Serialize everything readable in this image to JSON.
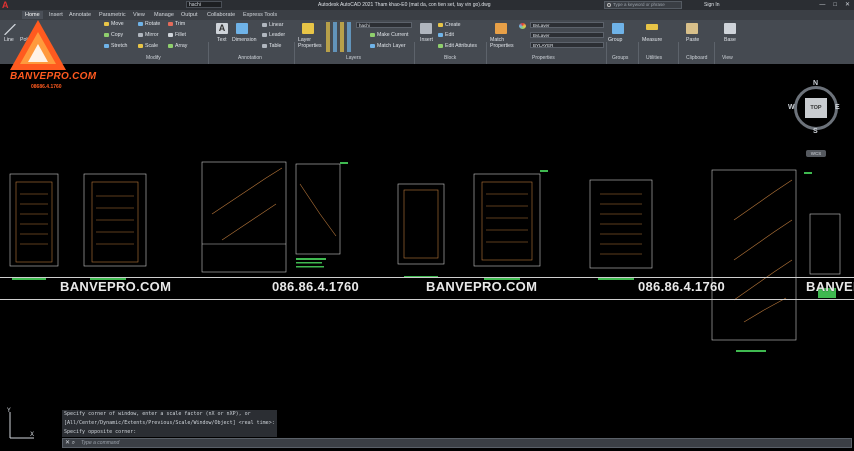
{
  "titlebar": {
    "app_logo": "A",
    "layer_quick": "hachi",
    "title": "Autodesk AutoCAD 2021   Tham khao-E0 (mat da, con tien set, tay vin go).dwg",
    "search_placeholder": "Type a keyword or phrase",
    "sign_in": "Sign In",
    "window_buttons": [
      "—",
      "□",
      "✕"
    ]
  },
  "tabs": [
    "Home",
    "Insert",
    "Annotate",
    "Parametric",
    "View",
    "Manage",
    "Output",
    "Collaborate",
    "Express Tools"
  ],
  "ribbon": {
    "draw": {
      "line": "Line",
      "polyline": "Polyline"
    },
    "modify": {
      "move": "Move",
      "rotate": "Rotate",
      "trim": "Trim",
      "copy": "Copy",
      "mirror": "Mirror",
      "fillet": "Fillet",
      "stretch": "Stretch",
      "scale": "Scale",
      "array": "Array",
      "title": "Modify"
    },
    "annotation": {
      "text": "Text",
      "dimension": "Dimension",
      "linear": "Linear",
      "leader": "Leader",
      "table": "Table",
      "title": "Annotation"
    },
    "layers": {
      "layer_properties": "Layer Properties",
      "layer_combo": "hachi",
      "make_current": "Make Current",
      "match_layer": "Match Layer",
      "title": "Layers"
    },
    "block": {
      "insert": "Insert",
      "create": "Create",
      "edit": "Edit",
      "edit_attributes": "Edit Attributes",
      "title": "Block"
    },
    "properties": {
      "match_properties": "Match Properties",
      "color": "ByLayer",
      "linetype": "ByLayer",
      "lineweight": "BYLAYER",
      "title": "Properties"
    },
    "groups": {
      "group": "Group",
      "title": "Groups"
    },
    "utilities": {
      "measure": "Measure",
      "title": "Utilities"
    },
    "clipboard": {
      "paste": "Paste",
      "title": "Clipboard"
    },
    "view": {
      "base": "Base",
      "title": "View"
    }
  },
  "brand": {
    "name": "BANVEPRO.COM",
    "phone": "08686.4.1760"
  },
  "watermarks": [
    "BANVEPRO.COM",
    "086.86.4.1760",
    "BANVEPRO.COM",
    "086.86.4.1760",
    "BANVEPRO"
  ],
  "viewcube": {
    "north": "N",
    "south": "S",
    "east": "E",
    "west": "W",
    "face": "TOP",
    "wcs": "WCS"
  },
  "command": {
    "history": [
      "Specify corner of window, enter a scale factor (nX or nXP), or",
      "[All/Center/Dynamic/Extents/Previous/Scale/Window/Object] <real time>:",
      "Specify opposite corner:"
    ],
    "placeholder": "Type a command"
  },
  "colors": {
    "accent": "#ff5a1f",
    "ribbon": "#454a51",
    "canvas": "#000000"
  }
}
